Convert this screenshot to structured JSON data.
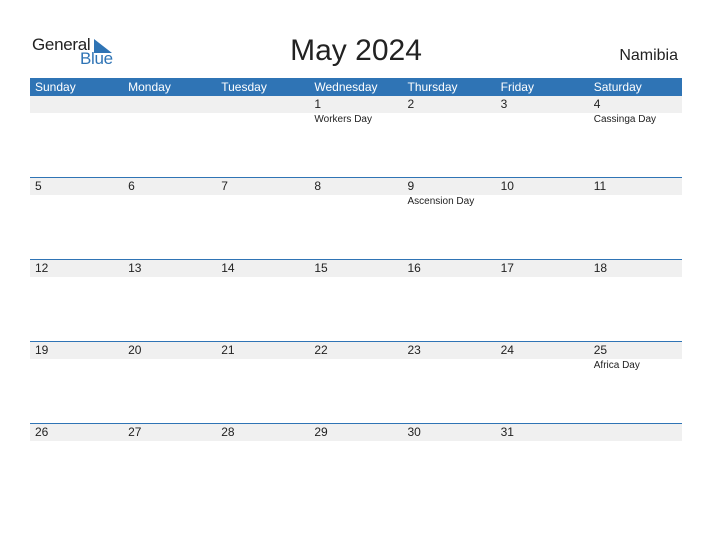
{
  "logo": {
    "general": "General",
    "blue": "Blue"
  },
  "title": "May 2024",
  "country": "Namibia",
  "colors": {
    "accent": "#2f74b5",
    "strip": "#f0f0f0"
  },
  "weekdays": [
    "Sunday",
    "Monday",
    "Tuesday",
    "Wednesday",
    "Thursday",
    "Friday",
    "Saturday"
  ],
  "weeks": [
    [
      {
        "day": "",
        "holiday": ""
      },
      {
        "day": "",
        "holiday": ""
      },
      {
        "day": "",
        "holiday": ""
      },
      {
        "day": "1",
        "holiday": "Workers Day"
      },
      {
        "day": "2",
        "holiday": ""
      },
      {
        "day": "3",
        "holiday": ""
      },
      {
        "day": "4",
        "holiday": "Cassinga Day"
      }
    ],
    [
      {
        "day": "5",
        "holiday": ""
      },
      {
        "day": "6",
        "holiday": ""
      },
      {
        "day": "7",
        "holiday": ""
      },
      {
        "day": "8",
        "holiday": ""
      },
      {
        "day": "9",
        "holiday": "Ascension Day"
      },
      {
        "day": "10",
        "holiday": ""
      },
      {
        "day": "11",
        "holiday": ""
      }
    ],
    [
      {
        "day": "12",
        "holiday": ""
      },
      {
        "day": "13",
        "holiday": ""
      },
      {
        "day": "14",
        "holiday": ""
      },
      {
        "day": "15",
        "holiday": ""
      },
      {
        "day": "16",
        "holiday": ""
      },
      {
        "day": "17",
        "holiday": ""
      },
      {
        "day": "18",
        "holiday": ""
      }
    ],
    [
      {
        "day": "19",
        "holiday": ""
      },
      {
        "day": "20",
        "holiday": ""
      },
      {
        "day": "21",
        "holiday": ""
      },
      {
        "day": "22",
        "holiday": ""
      },
      {
        "day": "23",
        "holiday": ""
      },
      {
        "day": "24",
        "holiday": ""
      },
      {
        "day": "25",
        "holiday": "Africa Day"
      }
    ],
    [
      {
        "day": "26",
        "holiday": ""
      },
      {
        "day": "27",
        "holiday": ""
      },
      {
        "day": "28",
        "holiday": ""
      },
      {
        "day": "29",
        "holiday": ""
      },
      {
        "day": "30",
        "holiday": ""
      },
      {
        "day": "31",
        "holiday": ""
      },
      {
        "day": "",
        "holiday": ""
      }
    ]
  ]
}
